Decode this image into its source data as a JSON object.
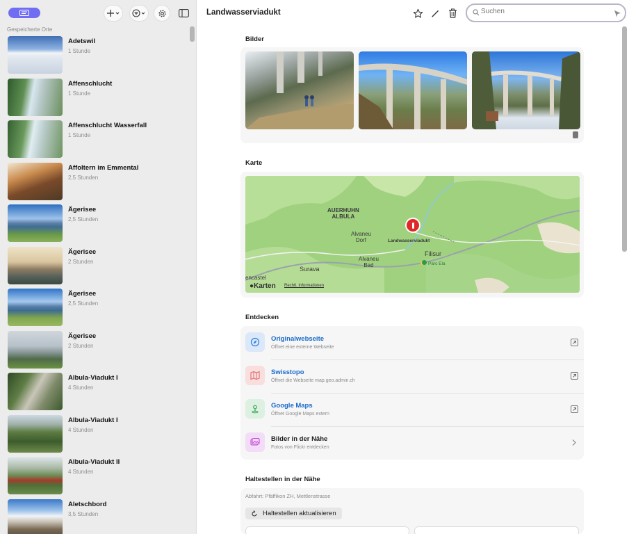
{
  "sidebar": {
    "section_label": "Gespeicherte Orte",
    "items": [
      {
        "title": "Adetswil",
        "subtitle": "1 Stunde"
      },
      {
        "title": "Affenschlucht",
        "subtitle": "1 Stunde"
      },
      {
        "title": "Affenschlucht Wasserfall",
        "subtitle": "1 Stunde"
      },
      {
        "title": "Affoltern im Emmental",
        "subtitle": "2,5 Stunden"
      },
      {
        "title": "Ägerisee",
        "subtitle": "2,5 Stunden"
      },
      {
        "title": "Ägerisee",
        "subtitle": "2 Stunden"
      },
      {
        "title": "Ägerisee",
        "subtitle": "2,5 Stunden"
      },
      {
        "title": "Ägerisee",
        "subtitle": "2 Stunden"
      },
      {
        "title": "Albula-Viadukt I",
        "subtitle": "4 Stunden"
      },
      {
        "title": "Albula-Viadukt I",
        "subtitle": "4 Stunden"
      },
      {
        "title": "Albula-Viadukt II",
        "subtitle": "4 Stunden"
      },
      {
        "title": "Aletschbord",
        "subtitle": "3,5 Stunden"
      }
    ]
  },
  "header": {
    "title": "Landwasserviadukt",
    "search_placeholder": "Suchen"
  },
  "sections": {
    "images": "Bilder",
    "map": "Karte",
    "discover": "Entdecken",
    "stops": "Haltestellen in der Nähe"
  },
  "map": {
    "labels": {
      "auerhuhn": "AUERHUHN\nALBULA",
      "alvaneu_dorf": "Alvaneu\nDorf",
      "landwasserviadukt": "Landwasserviadukt",
      "alvaneu_bad": "Alvaneu\nBad",
      "filisur": "Filisur",
      "parc_ela": "Parc Ela",
      "surava": "Surava",
      "encastel": "encastel"
    },
    "brand": "Karten",
    "legal": "Rechtl. Informationen"
  },
  "discover": [
    {
      "title": "Originalwebseite",
      "subtitle": "Öffnet eine externe Webseite",
      "icon": "compass-icon",
      "color": "#2f7ee0"
    },
    {
      "title": "Swisstopo",
      "subtitle": "Öffnet die Webseite map.geo.admin.ch",
      "icon": "map-icon",
      "color": "#e36a6a"
    },
    {
      "title": "Google Maps",
      "subtitle": "Öffnet Google Maps extern",
      "icon": "pin-icon",
      "color": "#3aa657"
    },
    {
      "title": "Bilder in der Nähe",
      "subtitle": "Fotos von Flickr entdecken",
      "icon": "photos-icon",
      "color": "#c34bd8"
    }
  ],
  "stops": {
    "departure": "Abfahrt: Pfäffikon ZH, Mettlenstrasse",
    "refresh_label": "Haltestellen aktualisieren"
  },
  "colors": {
    "accent": "#6f6df2",
    "link": "#1769c9",
    "pin": "#e0282a"
  }
}
